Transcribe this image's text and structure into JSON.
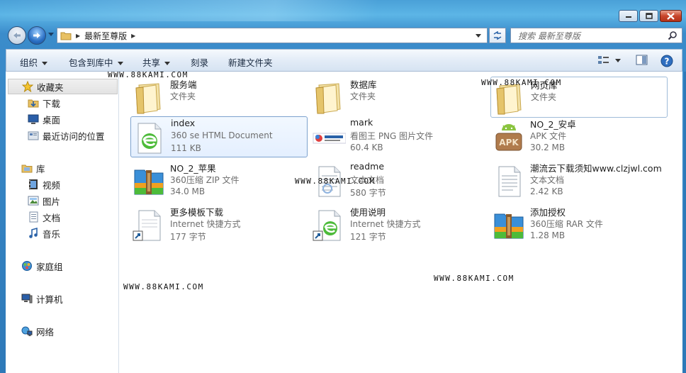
{
  "window": {
    "caption": {
      "minimize": "minimize-icon",
      "maximize": "maximize-icon",
      "close": "close-icon"
    }
  },
  "address": {
    "crumbs": [
      "最新至尊版"
    ],
    "search_placeholder": "搜索 最新至尊版"
  },
  "toolbar": {
    "organize": "组织",
    "include_in_library": "包含到库中",
    "share": "共享",
    "burn": "刻录",
    "new_folder": "新建文件夹"
  },
  "sidebar": {
    "favorites": {
      "label": "收藏夹",
      "items": [
        "下载",
        "桌面",
        "最近访问的位置"
      ]
    },
    "libraries": {
      "label": "库",
      "items": [
        "视频",
        "图片",
        "文档",
        "音乐"
      ]
    },
    "homegroup": "家庭组",
    "computer": "计算机",
    "network": "网络"
  },
  "files": [
    {
      "name": "服务端",
      "type": "文件夹",
      "size": "",
      "icon": "folder-icon"
    },
    {
      "name": "数据库",
      "type": "文件夹",
      "size": "",
      "icon": "folder-icon"
    },
    {
      "name": "网页库",
      "type": "文件夹",
      "size": "",
      "icon": "folder-icon"
    },
    {
      "name": "index",
      "type": "360 se HTML Document",
      "size": "111 KB",
      "icon": "html-document-icon"
    },
    {
      "name": "mark",
      "type": "看图王 PNG 图片文件",
      "size": "60.4 KB",
      "icon": "png-image-icon"
    },
    {
      "name": "NO_2_安卓",
      "type": "APK 文件",
      "size": "30.2 MB",
      "icon": "android-apk-icon"
    },
    {
      "name": "NO_2_苹果",
      "type": "360压缩 ZIP 文件",
      "size": "34.0 MB",
      "icon": "zip-archive-icon"
    },
    {
      "name": "readme",
      "type": "文本文档",
      "size": "580 字节",
      "icon": "text-document-icon"
    },
    {
      "name": "潮流云下载须知www.clzjwl.com",
      "type": "文本文档",
      "size": "2.42 KB",
      "icon": "text-document-icon"
    },
    {
      "name": "更多模板下载",
      "type": "Internet 快捷方式",
      "size": "177 字节",
      "icon": "internet-shortcut-icon"
    },
    {
      "name": "使用说明",
      "type": "Internet 快捷方式",
      "size": "121 字节",
      "icon": "internet-shortcut-icon"
    },
    {
      "name": "添加授权",
      "type": "360压缩 RAR 文件",
      "size": "1.28 MB",
      "icon": "rar-archive-icon"
    }
  ],
  "watermark": "WWW.88KAMI.COM",
  "colors": {
    "frame": "#2e79b8",
    "selection": "#e4efff",
    "selection_border": "#7da2ce"
  }
}
